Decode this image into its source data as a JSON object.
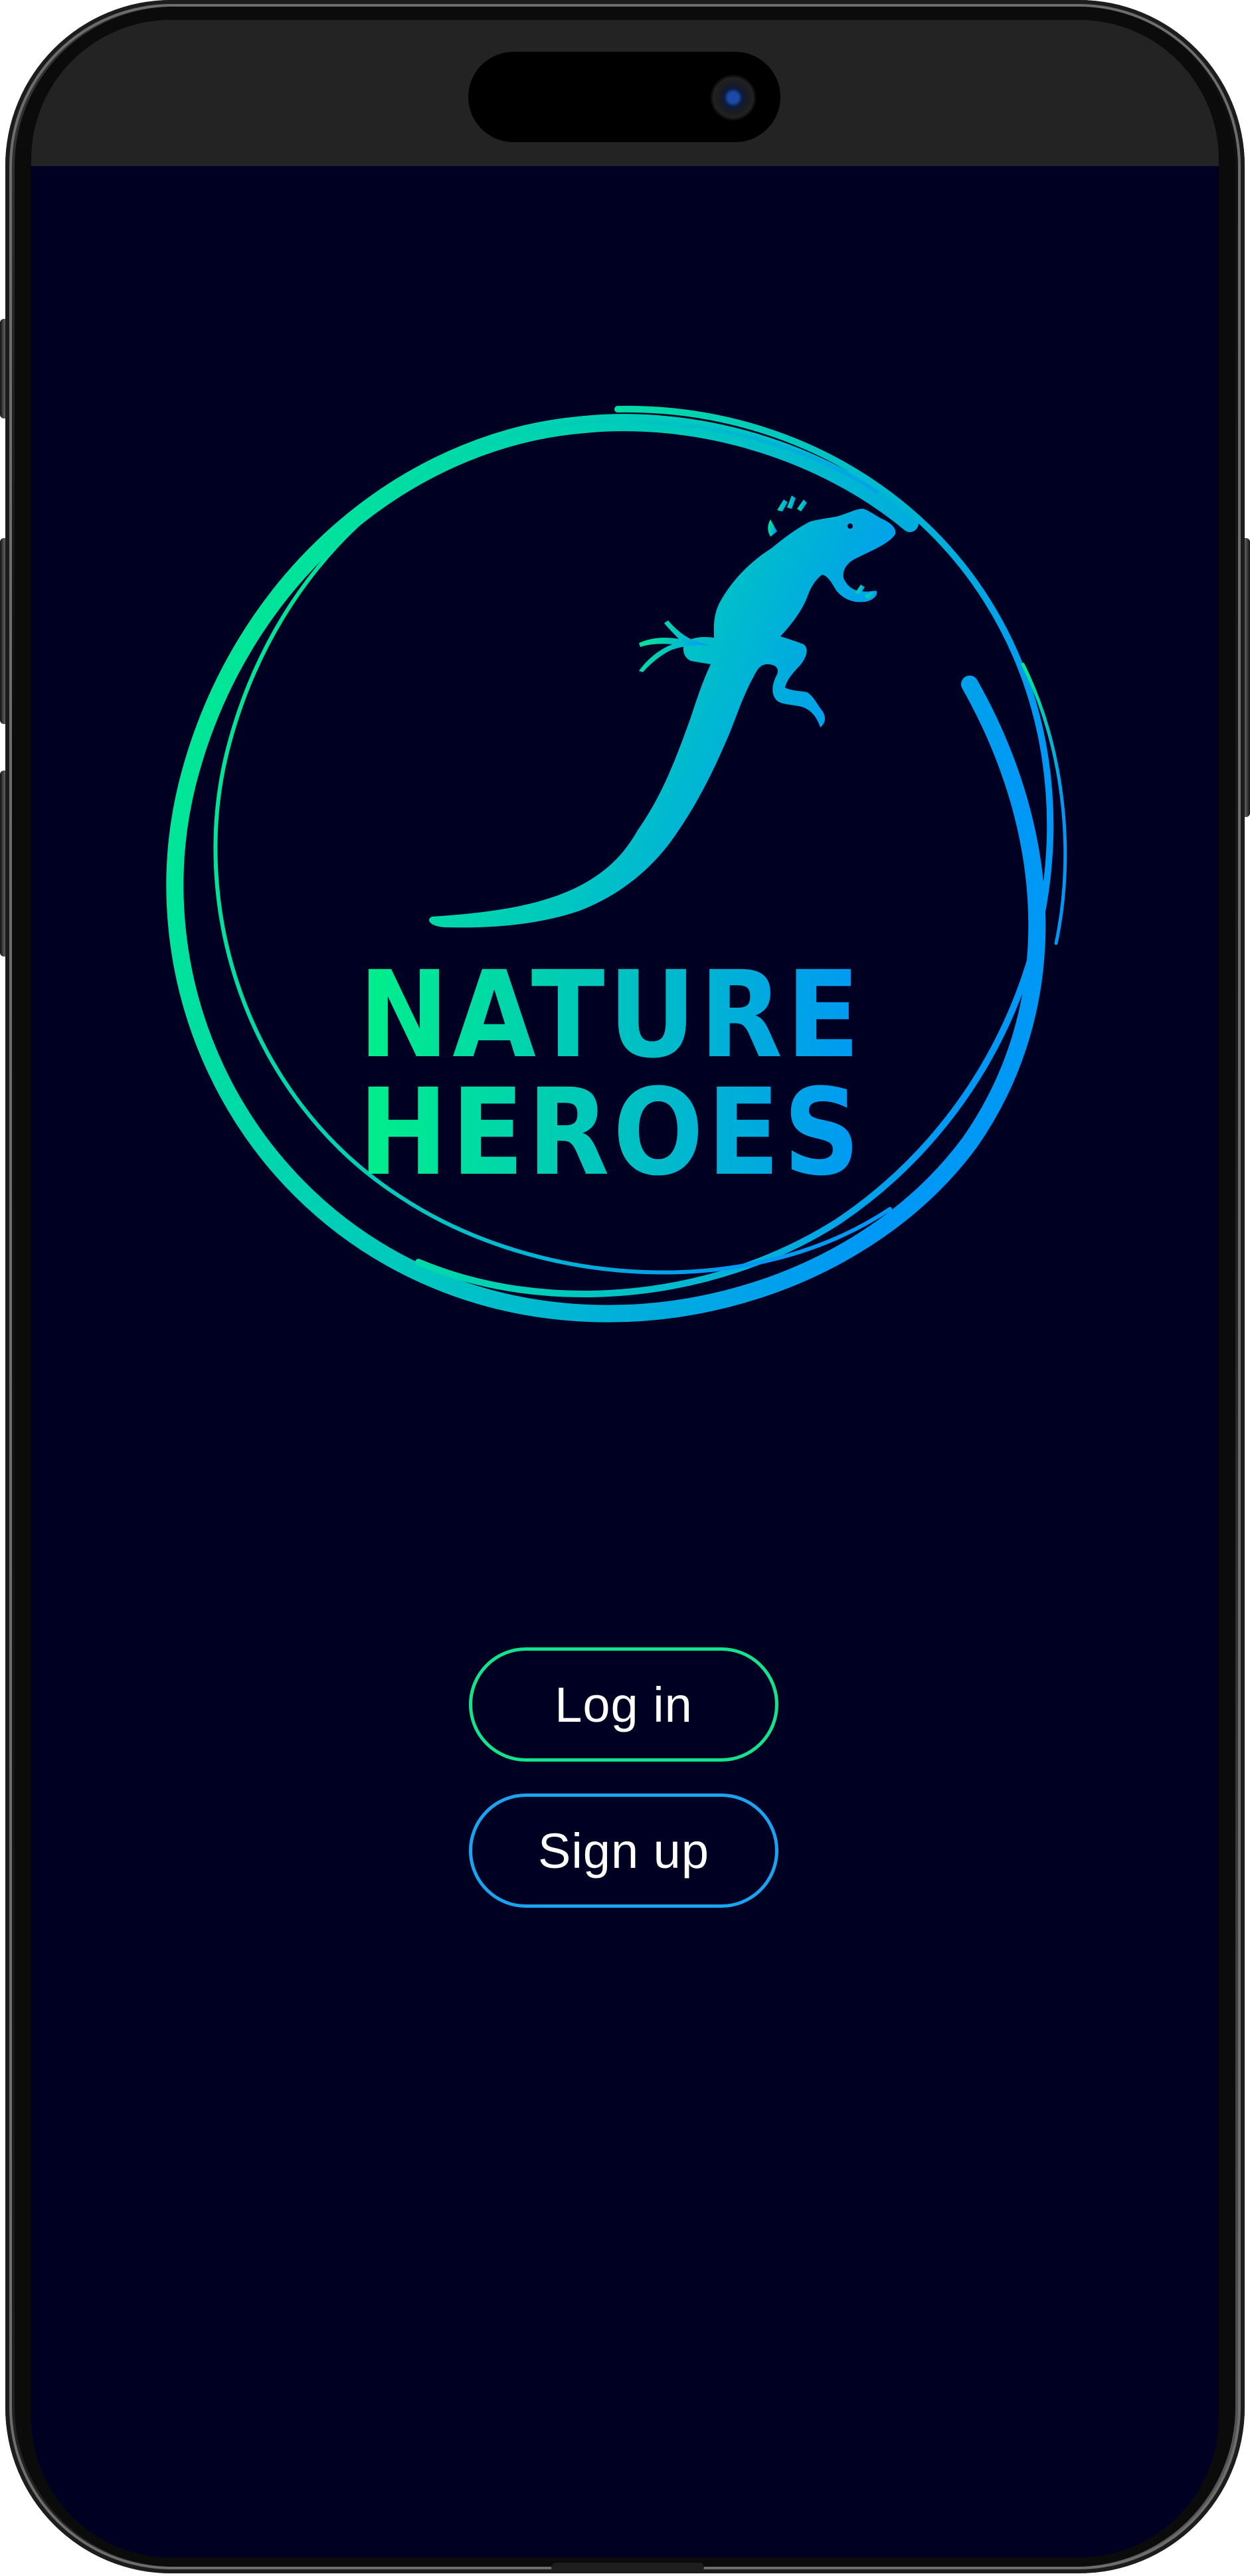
{
  "app": {
    "brand_line1": "NATURE",
    "brand_line2": "HEROES",
    "logo_icon": "lizard-icon"
  },
  "colors": {
    "background": "#000023",
    "gradient_start": "#00f08a",
    "gradient_end": "#0098f5",
    "login_border": "#13e38c",
    "signup_border": "#1aa3f0",
    "button_text": "#ffffff",
    "status_bar": "#232323"
  },
  "auth": {
    "login_label": "Log in",
    "signup_label": "Sign up"
  },
  "device": {
    "camera_icon": "camera-icon"
  }
}
